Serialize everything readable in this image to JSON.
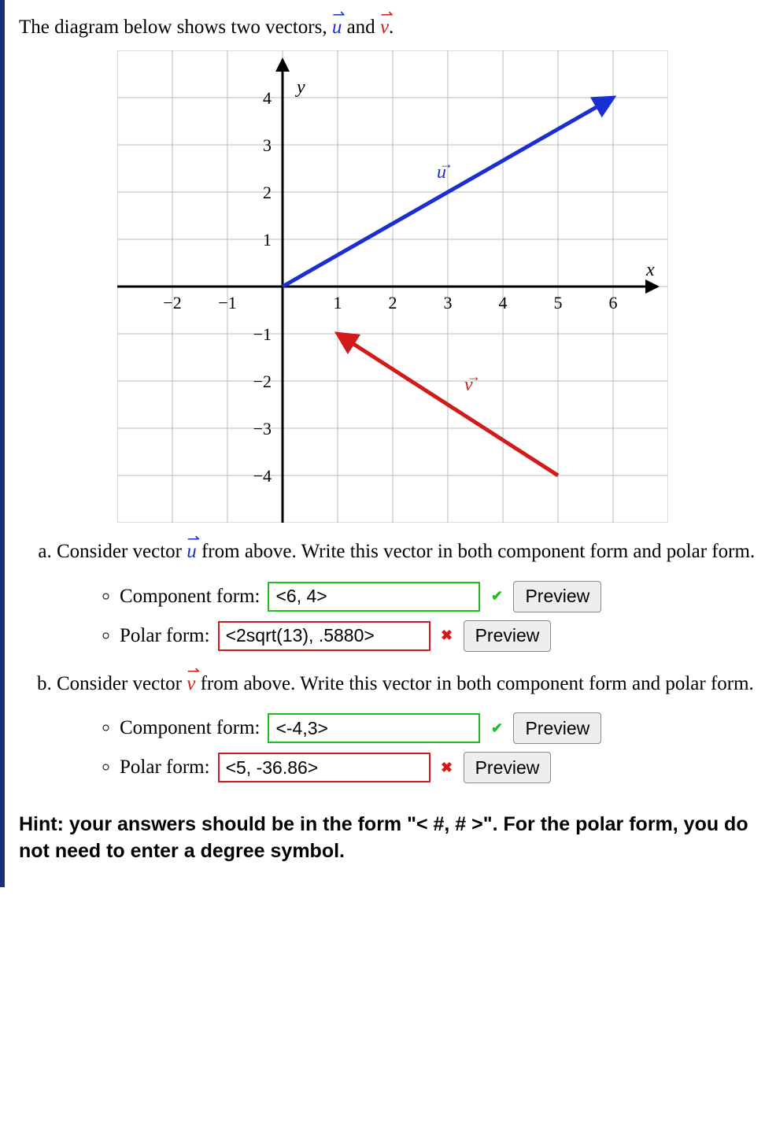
{
  "intro_prefix": "The diagram below shows two vectors, ",
  "intro_mid": " and ",
  "intro_end": ".",
  "uvec_letter": "u",
  "vvec_letter": "v",
  "parts": {
    "a": {
      "text_before": "Consider vector ",
      "text_after": " from above. Write this vector in both component form and polar form.",
      "component_label": "Component form: ",
      "polar_label": "Polar form: ",
      "component_value": "<6, 4>",
      "component_correct": true,
      "polar_value": "<2sqrt(13), .5880>",
      "polar_correct": false,
      "preview_label": "Preview"
    },
    "b": {
      "text_before": "Consider vector ",
      "text_after": " from above. Write this vector in both component form and polar form.",
      "component_label": "Component form: ",
      "polar_label": "Polar form: ",
      "component_value": "<-4,3>",
      "component_correct": true,
      "polar_value": "<5, -36.86>",
      "polar_correct": false,
      "preview_label": "Preview"
    }
  },
  "hint": "Hint: your answers should be in the form \"< #, # >\". For the polar form, you do not need to enter a degree symbol.",
  "chart_data": {
    "type": "vector-plot",
    "xlim": [
      -3,
      7
    ],
    "ylim": [
      -5,
      5
    ],
    "xlabel": "x",
    "ylabel": "y",
    "xticks": [
      -2,
      -1,
      1,
      2,
      3,
      4,
      5,
      6
    ],
    "yticks": [
      -4,
      -3,
      -2,
      -1,
      1,
      2,
      3,
      4
    ],
    "vectors": [
      {
        "name": "u",
        "color": "#1a2fd1",
        "tail": [
          0,
          0
        ],
        "head": [
          6,
          4
        ],
        "label_pos": [
          2.8,
          2.3
        ]
      },
      {
        "name": "v",
        "color": "#d11a1a",
        "tail": [
          5,
          -4
        ],
        "head": [
          1,
          -1
        ],
        "label_pos": [
          3.3,
          -2.2
        ]
      }
    ]
  }
}
